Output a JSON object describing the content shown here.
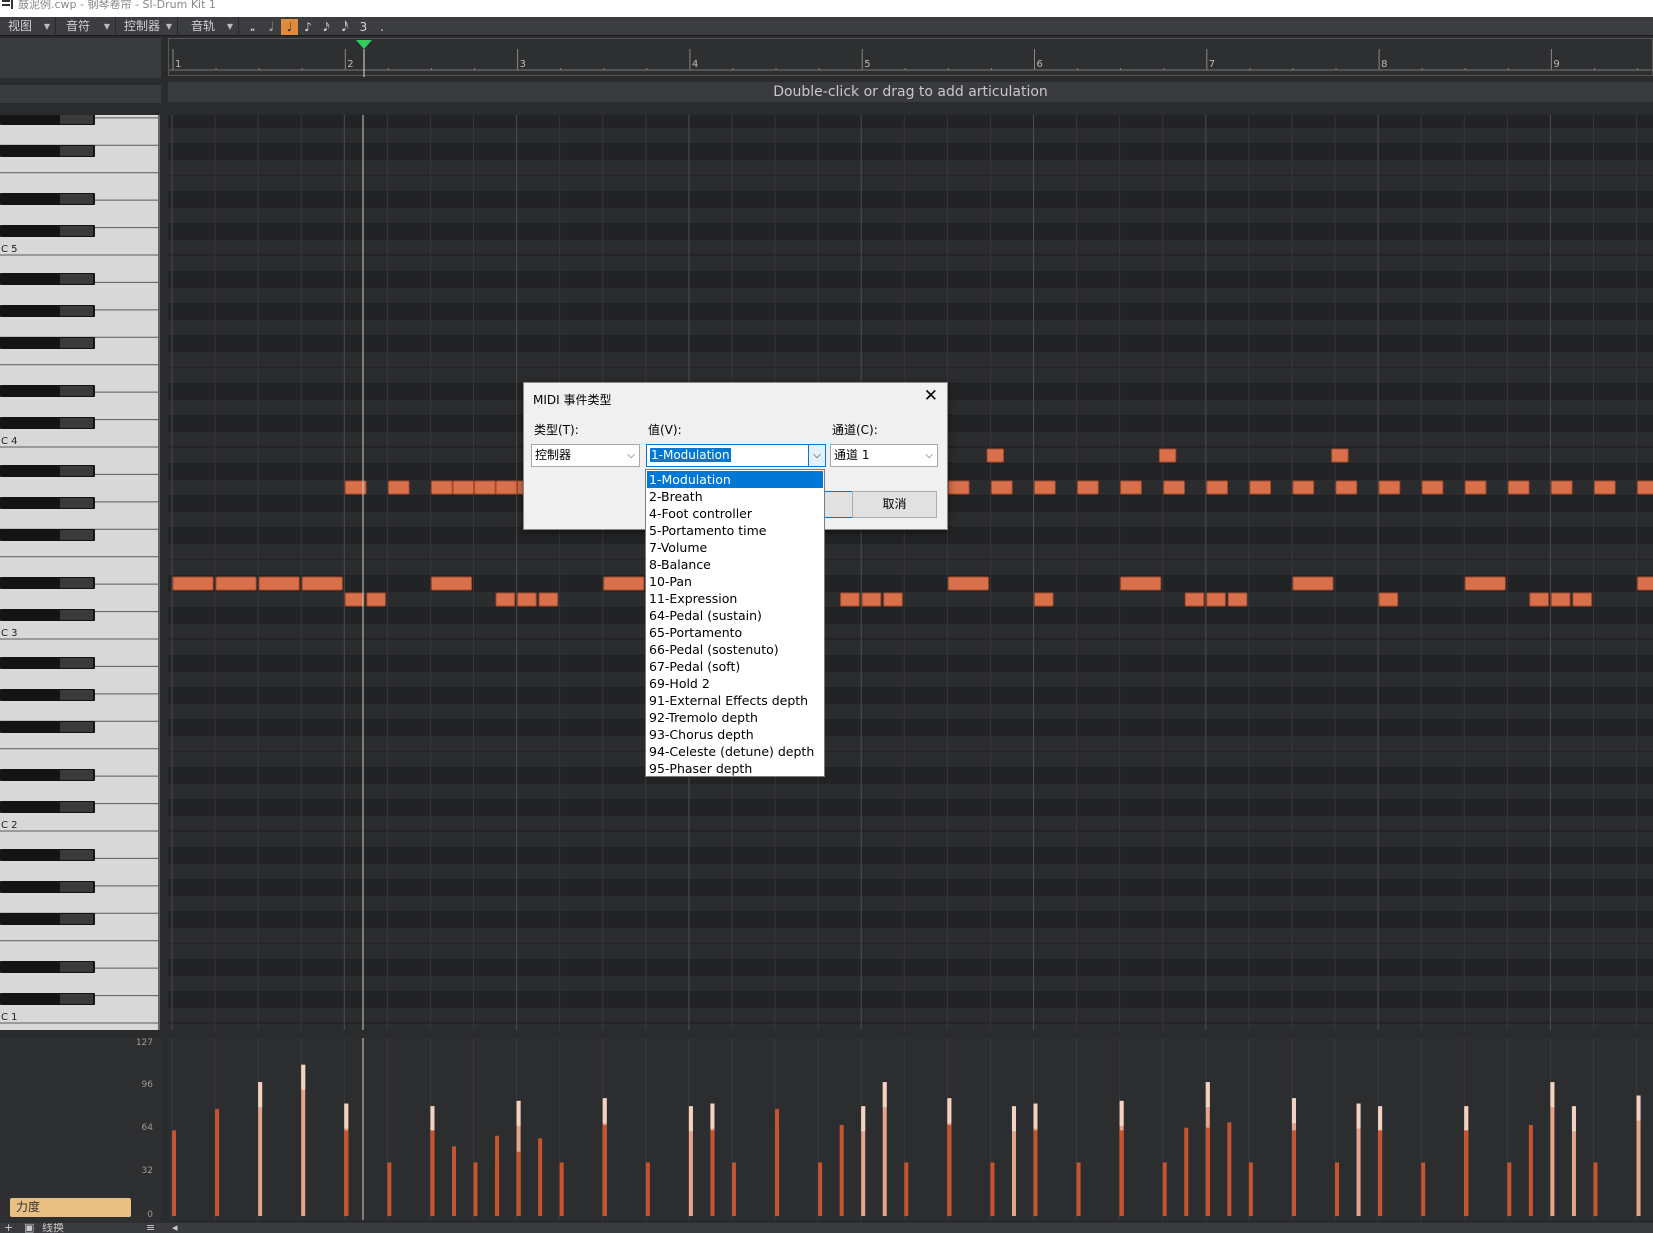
{
  "window": {
    "title": "鼓泥例.cwp - 钢琴卷帘 - SI-Drum Kit 1"
  },
  "menubar": {
    "items": [
      {
        "label": "视图"
      },
      {
        "label": "音符"
      },
      {
        "label": "控制器"
      },
      {
        "label": "音轨"
      }
    ],
    "note_buttons": [
      "𝅝",
      "𝅗𝅥",
      "♩",
      "♪",
      "𝅘𝅥𝅯",
      "𝅘𝅥𝅰",
      "3",
      "."
    ],
    "active_note_index": 2
  },
  "ruler": {
    "bars": [
      "1",
      "2",
      "3",
      "4",
      "5",
      "6",
      "7",
      "8",
      "9"
    ]
  },
  "articulation": {
    "hint": "Double-click or drag to add articulation"
  },
  "keyboard": {
    "octave_labels": [
      "C 5",
      "C 4",
      "C 3",
      "C 2",
      "C 1"
    ]
  },
  "velocity": {
    "pane_label": "力度",
    "scale": [
      "127",
      "96",
      "64",
      "32",
      "0"
    ]
  },
  "bottombar": {
    "label": "线换"
  },
  "dialog": {
    "title": "MIDI 事件类型",
    "close_glyph": "✕",
    "type_label": "类型(T):",
    "type_value": "控制器",
    "value_label": "值(V):",
    "value_value": "1-Modulation",
    "channel_label": "通道(C):",
    "channel_value": "通道 1",
    "ok_label": "",
    "cancel_label": "取消",
    "dropdown_options": [
      "1-Modulation",
      "2-Breath",
      "4-Foot controller",
      "5-Portamento time",
      "7-Volume",
      "8-Balance",
      "10-Pan",
      "11-Expression",
      "64-Pedal (sustain)",
      "65-Portamento",
      "66-Pedal (sostenuto)",
      "67-Pedal (soft)",
      "69-Hold 2",
      "91-External Effects depth",
      "92-Tremolo depth",
      "93-Chorus depth",
      "94-Celeste (detune) depth",
      "95-Phaser depth"
    ],
    "selected_index": 0
  },
  "colors": {
    "note": "#d9704c",
    "note_border": "#a44a2c",
    "accent": "#e08a3c",
    "playhead": "#2fcf5a",
    "selection": "#0078d7"
  }
}
